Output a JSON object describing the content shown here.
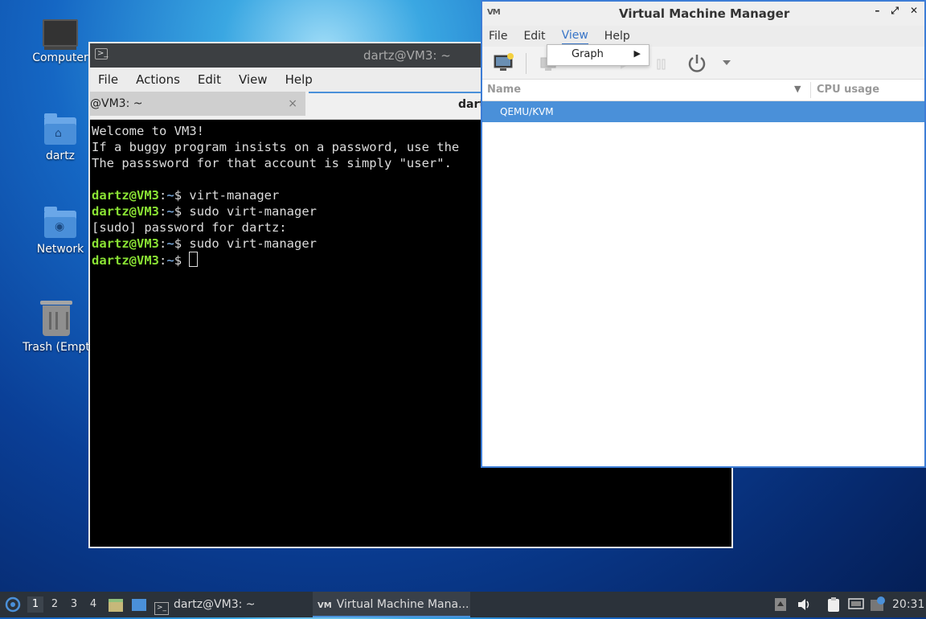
{
  "desktop": {
    "icons": [
      {
        "label": "Computer"
      },
      {
        "label": "dartz"
      },
      {
        "label": "Network"
      },
      {
        "label": "Trash (Empt"
      }
    ]
  },
  "terminal": {
    "title": "dartz@VM3: ~",
    "menu": [
      "File",
      "Actions",
      "Edit",
      "View",
      "Help"
    ],
    "tabs": [
      {
        "label": "@VM3: ~",
        "close": "×"
      },
      {
        "label": "dartz"
      }
    ],
    "lines": [
      "Welcome to VM3!",
      "If a buggy program insists on a password, use the",
      "The passsword for that account is simply \"user\"."
    ],
    "prompt_user": "dartz@VM3",
    "prompt_sep": ":",
    "prompt_dir": "~",
    "prompt_end": "$ ",
    "commands": [
      "virt-manager",
      "sudo virt-manager"
    ],
    "sudo_prompt": "[sudo] password for dartz:",
    "command3": "sudo virt-manager"
  },
  "vmm": {
    "title": "Virtual Machine Manager",
    "logo": "VM",
    "menu": [
      "File",
      "Edit",
      "View",
      "Help"
    ],
    "active_menu": "View",
    "columns": {
      "name": "Name",
      "cpu": "CPU usage"
    },
    "rows": [
      {
        "label": "QEMU/KVM",
        "selected": true
      }
    ],
    "dropdown": {
      "items": [
        {
          "label": "Graph",
          "has_submenu": true
        }
      ]
    }
  },
  "taskbar": {
    "workspaces": [
      "1",
      "2",
      "3",
      "4"
    ],
    "active_workspace": "1",
    "tasks": [
      {
        "label": "dartz@VM3: ~",
        "active": false
      },
      {
        "label": "Virtual Machine Mana...",
        "active": true
      }
    ],
    "clock": "20:31"
  },
  "colors": {
    "accent": "#4a90d9",
    "prompt_green": "#8ae234",
    "prompt_blue": "#729fcf"
  }
}
